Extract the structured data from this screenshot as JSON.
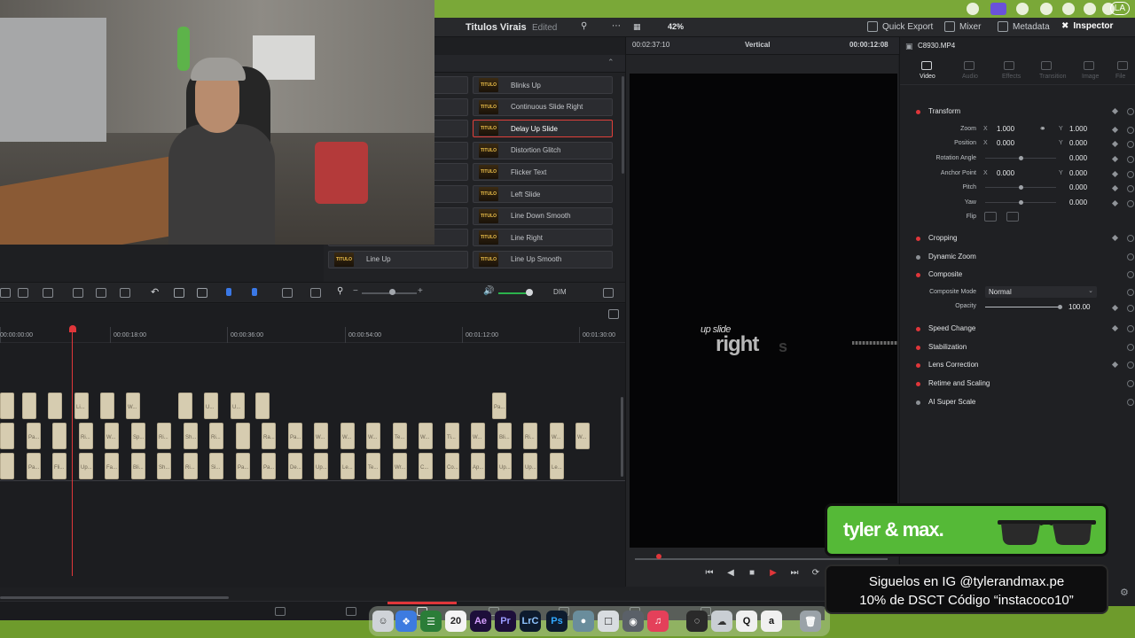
{
  "project": {
    "title": "Titulos Virais",
    "status": "Edited"
  },
  "topbar": {
    "quick_export": "Quick Export",
    "mixer": "Mixer",
    "metadata": "Metadata",
    "inspector": "Inspector"
  },
  "effects": {
    "left": [
      "",
      "",
      "",
      "",
      "",
      "",
      "",
      "",
      "Line Up"
    ],
    "right": [
      "Blinks Up",
      "Continuous Slide Right",
      "Delay Up Slide",
      "Distortion Glitch",
      "Flicker Text",
      "Left Slide",
      "Line Down Smooth",
      "Line Right",
      "Line Up Smooth"
    ],
    "selected": "Delay Up Slide",
    "thumb_text": "TITULO"
  },
  "timeline_toolbar": {
    "dim": "DIM"
  },
  "timeline": {
    "timecodes": [
      "00:00:00:00",
      "00:00:18:00",
      "00:00:36:00",
      "00:00:54:00",
      "00:01:12:00",
      "00:01:30:00"
    ],
    "track1_labels": [
      "",
      "",
      "",
      "Li...",
      "",
      "W...",
      "",
      "U...",
      "U...",
      "",
      "Pa..."
    ],
    "track2_labels": [
      "",
      "Pa...",
      "",
      "Ri...",
      "W...",
      "Sp...",
      "Ri...",
      "Sh...",
      "Ri...",
      "",
      "Ra...",
      "Pa...",
      "W...",
      "W...",
      "W...",
      "Te...",
      "W...",
      "Ti...",
      "W...",
      "Bli...",
      "Ri...",
      "W...",
      "W..."
    ],
    "track3_labels": [
      "",
      "Pa...",
      "Fli...",
      "Up...",
      "Fa...",
      "Bli...",
      "Sh...",
      "Ri...",
      "Si...",
      "Pa...",
      "Pa...",
      "De...",
      "Up...",
      "Le...",
      "Te...",
      "Wr...",
      "C...",
      "Co...",
      "Ap...",
      "Up...",
      "Up...",
      "Le..."
    ]
  },
  "viewer": {
    "timecode_left": "00:02:37:10",
    "mode": "Vertical",
    "timecode_right": "00:00:12:08",
    "zoom": "42%",
    "title_small": "up slide",
    "title_big": "right",
    "title_ghost": "s"
  },
  "inspector": {
    "clip_name": "C8930.MP4",
    "tabs": [
      "Video",
      "Audio",
      "Effects",
      "Transition",
      "Image",
      "File"
    ],
    "transform": {
      "title": "Transform",
      "zoom_label": "Zoom",
      "zoom_x": "1.000",
      "zoom_y": "1.000",
      "position_label": "Position",
      "position_x": "0.000",
      "position_y": "0.000",
      "rotation_label": "Rotation Angle",
      "rotation": "0.000",
      "anchor_label": "Anchor Point",
      "anchor_x": "0.000",
      "anchor_y": "0.000",
      "pitch_label": "Pitch",
      "pitch": "0.000",
      "yaw_label": "Yaw",
      "yaw": "0.000",
      "flip_label": "Flip"
    },
    "sections": {
      "cropping": "Cropping",
      "dynamic_zoom": "Dynamic Zoom",
      "composite": "Composite",
      "speed_change": "Speed Change",
      "stabilization": "Stabilization",
      "lens_correction": "Lens Correction",
      "retime": "Retime and Scaling",
      "super_scale": "AI Super Scale"
    },
    "composite": {
      "mode_label": "Composite Mode",
      "mode": "Normal",
      "opacity_label": "Opacity",
      "opacity": "100.00"
    },
    "axis_x": "X",
    "axis_y": "Y"
  },
  "dock": {
    "date_day": "20",
    "ae": "Ae",
    "pr": "Pr",
    "lrc": "LrC",
    "ps": "Ps",
    "a": "a"
  },
  "promo": {
    "brand": "tyler & max.",
    "line1": "Siguelos en IG @tylerandmax.pe",
    "line2": "10% de DSCT Código “instacoco10”"
  },
  "menubar": {
    "tz": "LA"
  },
  "colors": {
    "accent": "#e0363a",
    "desktop_green": "#6e9b2c",
    "promo_green": "#55b937"
  }
}
